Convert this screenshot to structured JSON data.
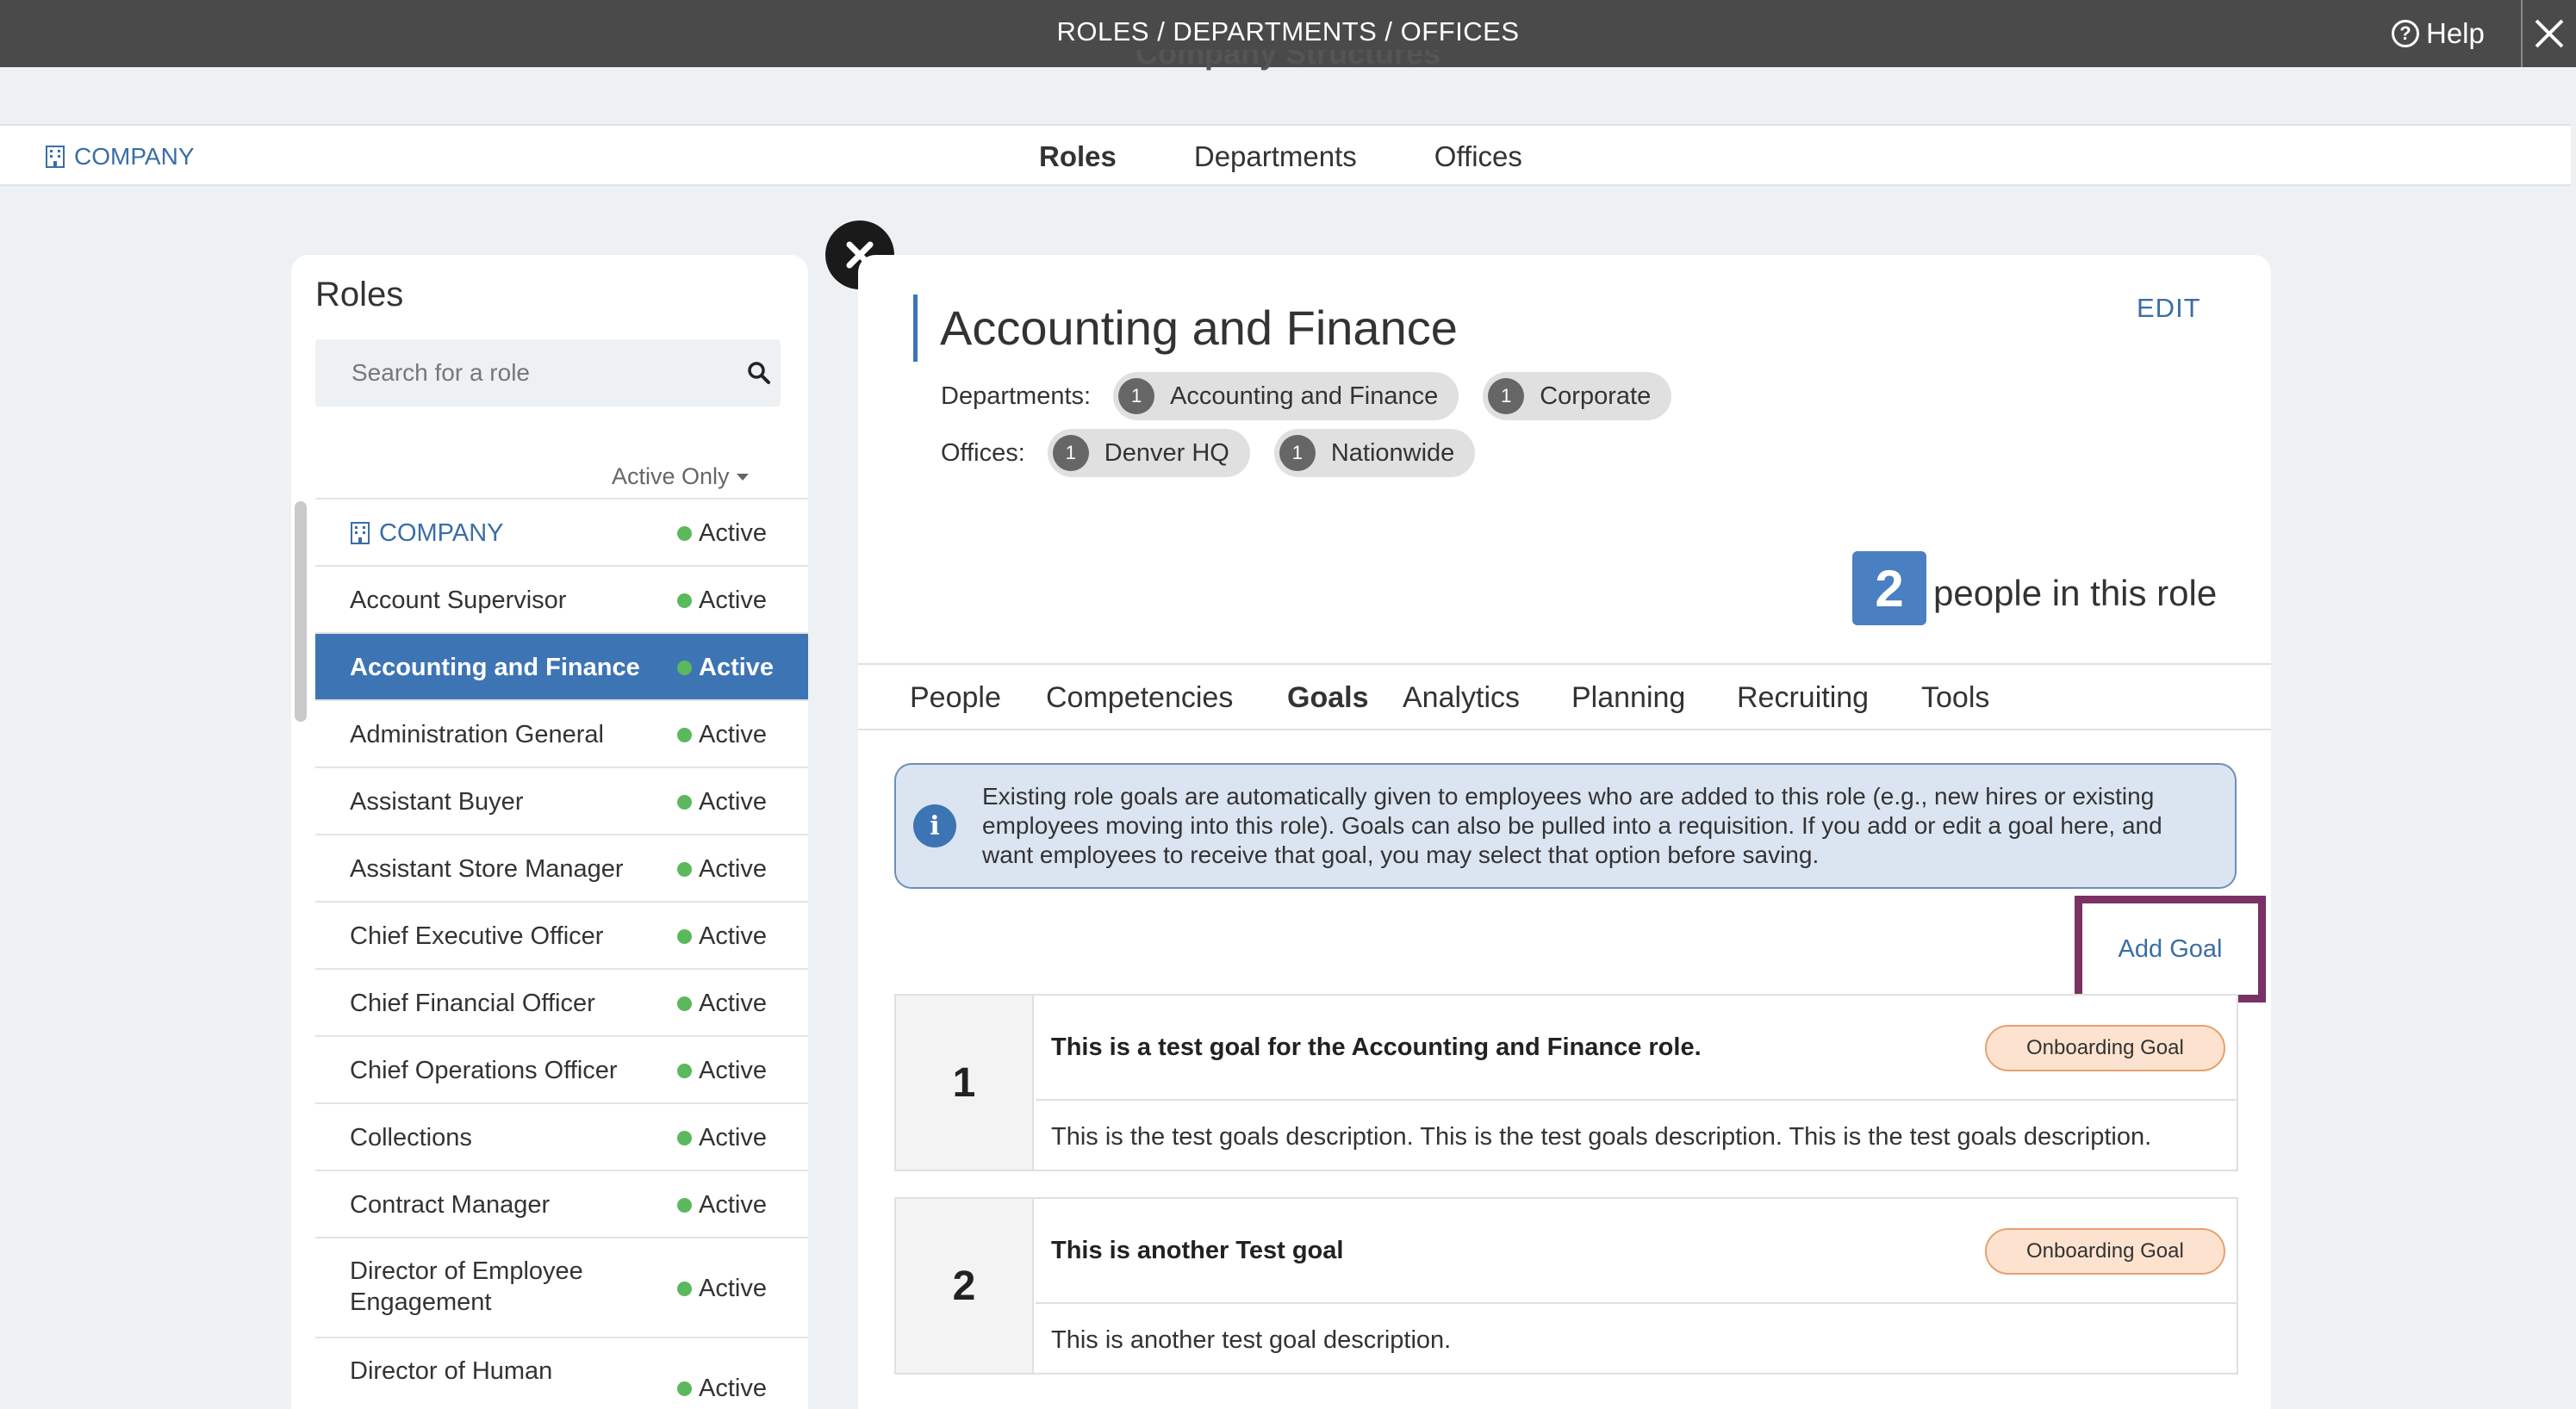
{
  "topbar": {
    "title": "ROLES / DEPARTMENTS / OFFICES",
    "help_label": "Help"
  },
  "behind_title": "Company Structures",
  "subnav": {
    "company_label": "COMPANY",
    "tabs": [
      "Roles",
      "Departments",
      "Offices"
    ],
    "active_tab": "Roles"
  },
  "roles_panel": {
    "heading": "Roles",
    "search_placeholder": "Search for a role",
    "filter_label": "Active Only",
    "items": [
      {
        "name": "COMPANY",
        "status": "Active",
        "is_company": true
      },
      {
        "name": "Account Supervisor",
        "status": "Active"
      },
      {
        "name": "Accounting and Finance",
        "status": "Active",
        "selected": true
      },
      {
        "name": "Administration General",
        "status": "Active"
      },
      {
        "name": "Assistant Buyer",
        "status": "Active"
      },
      {
        "name": "Assistant Store Manager",
        "status": "Active"
      },
      {
        "name": "Chief Executive Officer",
        "status": "Active"
      },
      {
        "name": "Chief Financial Officer",
        "status": "Active"
      },
      {
        "name": "Chief Operations Officer",
        "status": "Active"
      },
      {
        "name": "Collections",
        "status": "Active"
      },
      {
        "name": "Contract Manager",
        "status": "Active"
      },
      {
        "name": "Director of Employee Engagement",
        "status": "Active"
      },
      {
        "name": "Director of Human",
        "status": "Active"
      }
    ]
  },
  "role_detail": {
    "title": "Accounting and Finance",
    "edit_label": "EDIT",
    "departments_label": "Departments:",
    "departments": [
      {
        "count": "1",
        "name": "Accounting and Finance"
      },
      {
        "count": "1",
        "name": "Corporate"
      }
    ],
    "offices_label": "Offices:",
    "offices": [
      {
        "count": "1",
        "name": "Denver HQ"
      },
      {
        "count": "1",
        "name": "Nationwide"
      }
    ],
    "people_count": "2",
    "people_label": "people in this role",
    "tabs": [
      "People",
      "Competencies",
      "Goals",
      "Analytics",
      "Planning",
      "Recruiting",
      "Tools"
    ],
    "active_tab": "Goals",
    "info_icon": "info-icon",
    "info_text": "Existing role goals are automatically given to employees who are added to this role (e.g., new hires or existing employees moving into this role). Goals can also be pulled into a requisition. If you add or edit a goal here, and want employees to receive that goal, you may select that option before saving.",
    "add_goal_label": "Add Goal",
    "goals": [
      {
        "number": "1",
        "title": "This is a test goal for the Accounting and Finance role.",
        "tag": "Onboarding Goal",
        "description": "This is the test goals description. This is the test goals description. This is the test goals description."
      },
      {
        "number": "2",
        "title": "This is another Test goal",
        "tag": "Onboarding Goal",
        "description": "This is another test goal description."
      }
    ]
  },
  "colors": {
    "topbar": "#4a4a4a",
    "accent": "#3d74b4",
    "active_dot": "#5cb85c",
    "highlight_border": "#7a3166",
    "tag_bg": "#fde3cf"
  }
}
